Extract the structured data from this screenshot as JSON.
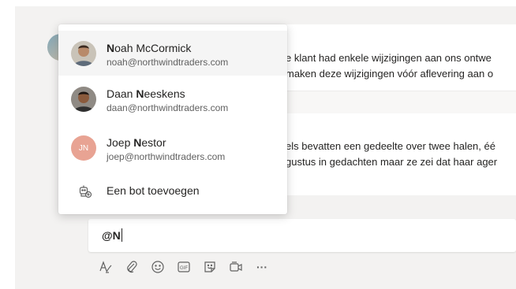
{
  "conversation": {
    "message1": {
      "lines": [
        "e klant had enkele wijzigingen aan ons ontwe",
        "maken deze wijzigingen vóór aflevering aan o"
      ]
    },
    "message2": {
      "lines": [
        "els bevatten een gedeelte over twee halen, éé",
        "gustus in gedachten maar ze zei dat haar ager"
      ]
    }
  },
  "mention_dropdown": {
    "items": [
      {
        "name_prefix": "",
        "name_bold": "N",
        "name_rest": "oah McCormick",
        "email": "noah@northwindtraders.com",
        "avatar_icon": "person-photo-avatar"
      },
      {
        "name_prefix": "Daan ",
        "name_bold": "N",
        "name_rest": "eeskens",
        "email": "daan@northwindtraders.com",
        "avatar_icon": "person-photo-avatar"
      },
      {
        "name_prefix": "Joep ",
        "name_bold": "N",
        "name_rest": "estor",
        "email": "joep@northwindtraders.com",
        "avatar_initials": "JN",
        "avatar_color": "#e8a393"
      }
    ],
    "add_bot_label": "Een bot toevoegen",
    "add_bot_icon": "add-bot-icon"
  },
  "compose": {
    "value": "@N"
  },
  "toolbar": {
    "icons": [
      "format-icon",
      "attach-icon",
      "emoji-icon",
      "gif-icon",
      "sticker-icon",
      "meet-now-icon",
      "more-options-icon"
    ],
    "gif_label": "GIF",
    "more_label": "···"
  },
  "colors": {
    "app_background": "#f3f2f1",
    "initials_avatar": "#e8a393",
    "selected_row": "#f5f5f5"
  }
}
